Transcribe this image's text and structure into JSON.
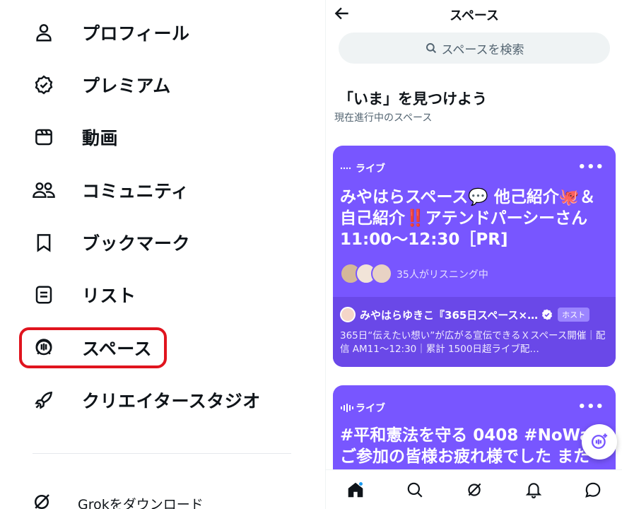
{
  "menu": {
    "items": [
      {
        "label": "プロフィール",
        "icon": "person-icon"
      },
      {
        "label": "プレミアム",
        "icon": "verified-badge-icon"
      },
      {
        "label": "動画",
        "icon": "video-icon"
      },
      {
        "label": "コミュニティ",
        "icon": "people-icon"
      },
      {
        "label": "ブックマーク",
        "icon": "bookmark-icon"
      },
      {
        "label": "リスト",
        "icon": "list-icon"
      },
      {
        "label": "スペース",
        "icon": "spaces-icon"
      },
      {
        "label": "クリエイタースタジオ",
        "icon": "rocket-icon"
      }
    ],
    "grok_label": "Grokをダウンロード",
    "highlight_color": "#e0141e"
  },
  "spaces": {
    "title": "スペース",
    "search_placeholder": "スペースを検索",
    "section_title": "「いま」を見つけよう",
    "section_subtitle": "現在進行中のスペース",
    "accent_color": "#7856ff",
    "cards": [
      {
        "live_label": "ライブ",
        "more": "•••",
        "title": "みやはらスペース💬 他己紹介🐙＆自己紹介‼️アテンドパーシーさん11:00〜12:30［PR]",
        "listeners": "35人がリスニング中",
        "host_name": "みやはらゆきこ『365日スペース×…",
        "host_badge": "ホスト",
        "host_desc": "365日“伝えたい想い”が広がる宣伝できるＸスペース開催｜配信 AM11～12:30｜累計 1500日超ライブ配…"
      },
      {
        "live_label": "ライブ",
        "more": "•••",
        "title_line1": "#平和憲法を守る 0408 #NoWa",
        "title_line2": "ご参加の皆様お疲れ様でした また"
      }
    ]
  },
  "nav": [
    "home-icon",
    "search-icon",
    "grok-icon",
    "notifications-icon",
    "messages-icon"
  ]
}
